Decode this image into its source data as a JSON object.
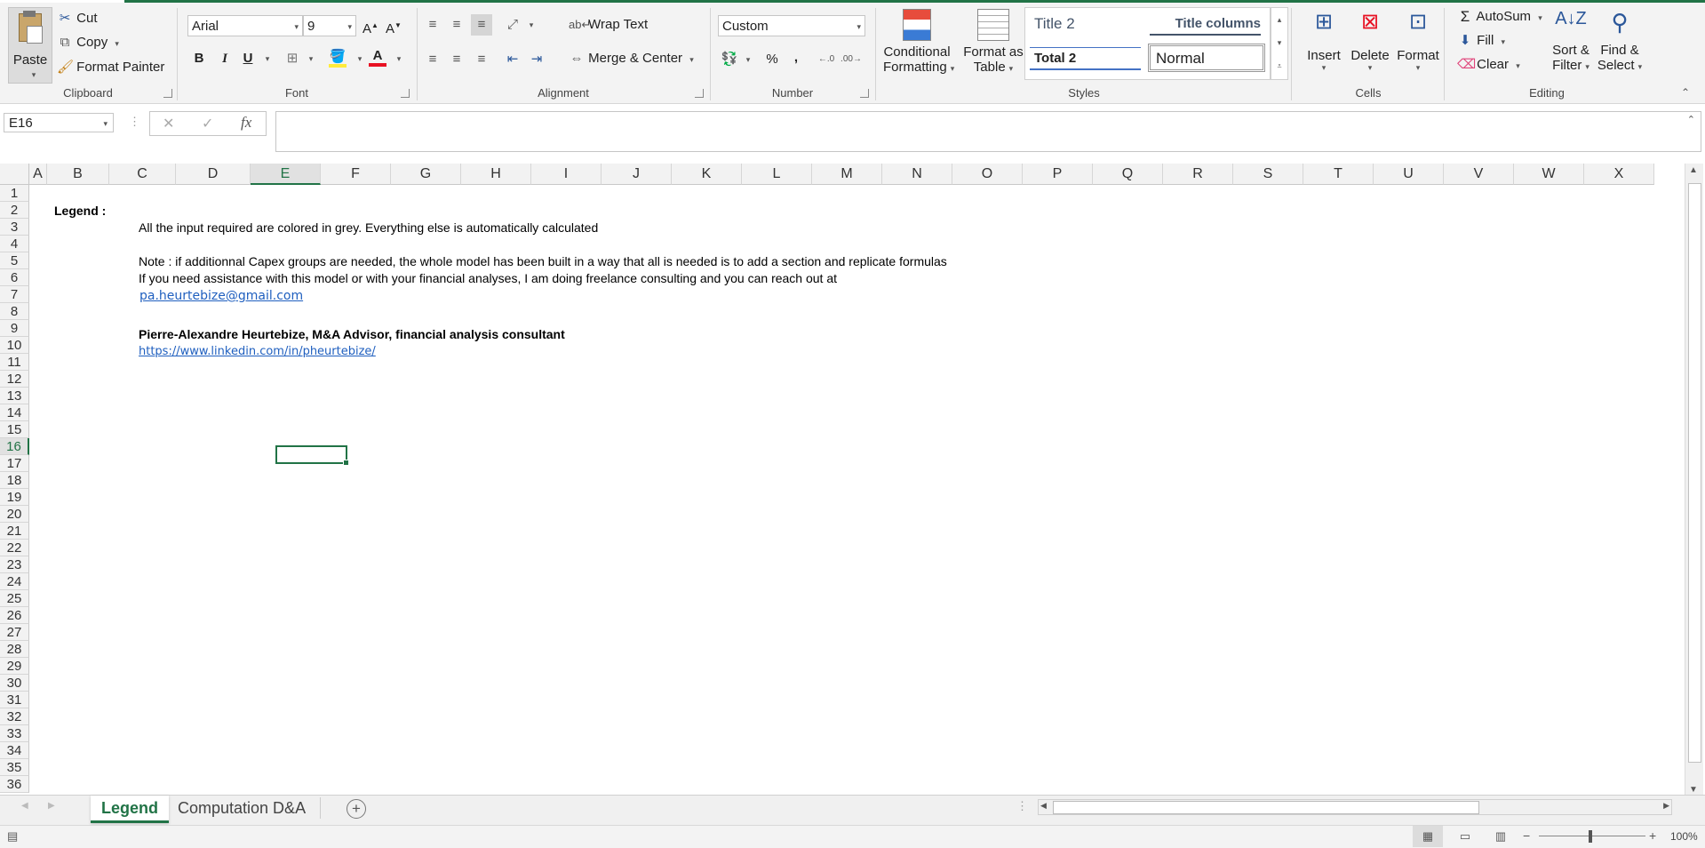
{
  "clipboard": {
    "paste": "Paste",
    "cut": "Cut",
    "copy": "Copy",
    "format_painter": "Format Painter",
    "group": "Clipboard"
  },
  "font": {
    "name": "Arial",
    "size": "9",
    "bold": "B",
    "italic": "I",
    "underline": "U",
    "group": "Font",
    "fill_color": "#ffeb3b",
    "font_color": "#e81123"
  },
  "alignment": {
    "wrap_text": "Wrap Text",
    "merge_center": "Merge & Center",
    "group": "Alignment"
  },
  "number": {
    "format": "Custom",
    "percent": "%",
    "comma": ",",
    "group": "Number"
  },
  "styles": {
    "conditional_formatting": "Conditional",
    "conditional_formatting_2": "Formatting",
    "format_as_table": "Format as",
    "format_as_table_2": "Table",
    "title2": "Title 2",
    "title_columns": "Title columns",
    "total2": "Total 2",
    "normal": "Normal",
    "group": "Styles"
  },
  "cells": {
    "insert": "Insert",
    "delete": "Delete",
    "format": "Format",
    "group": "Cells"
  },
  "editing": {
    "autosum": "AutoSum",
    "fill": "Fill",
    "clear": "Clear",
    "sort_filter": "Sort &",
    "sort_filter_2": "Filter",
    "find_select": "Find &",
    "find_select_2": "Select",
    "group": "Editing"
  },
  "formula_bar": {
    "name_box": "E16",
    "fx": "fx",
    "cancel": "✕",
    "enter": "✓",
    "value": ""
  },
  "columns": [
    "A",
    "B",
    "C",
    "D",
    "E",
    "F",
    "G",
    "H",
    "I",
    "J",
    "K",
    "L",
    "M",
    "N",
    "O",
    "P",
    "Q",
    "R",
    "S",
    "T",
    "U",
    "V",
    "W",
    "X"
  ],
  "active_column": "E",
  "rows": [
    "1",
    "2",
    "3",
    "4",
    "5",
    "6",
    "7",
    "8",
    "9",
    "10",
    "11",
    "12",
    "13",
    "14",
    "15",
    "16",
    "17",
    "18",
    "19",
    "20",
    "21",
    "22",
    "23",
    "24",
    "25",
    "26",
    "27",
    "28",
    "29",
    "30",
    "31",
    "32",
    "33",
    "34",
    "35",
    "36"
  ],
  "active_row": "16",
  "cells_content": {
    "legend": "Legend :",
    "r3": "All the input required are colored in grey. Everything else is automatically calculated",
    "r5": "Note : if additionnal Capex groups are needed, the whole model has been built in a way that all is needed is to add a section and replicate formulas",
    "r6": "If you need assistance with this model or with your financial analyses, I am doing freelance consulting and you can reach out at",
    "r7": "pa.heurtebize@gmail.com",
    "r9": "Pierre-Alexandre Heurtebize, M&A Advisor, financial analysis consultant",
    "r10": "https://www.linkedin.com/in/pheurtebize/"
  },
  "sheets": {
    "tab1": "Legend",
    "tab2": "Computation D&A",
    "add": "+"
  },
  "status": {
    "zoom": "100%"
  }
}
